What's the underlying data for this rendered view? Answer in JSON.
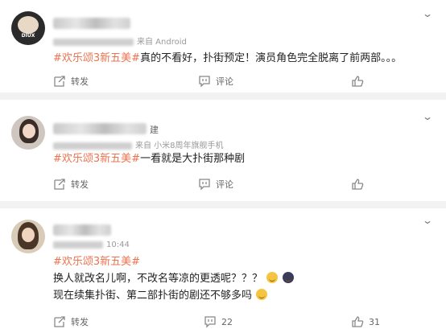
{
  "posts": [
    {
      "source": "来自 Android",
      "text_tag": "#欢乐颂3新五美#",
      "text": "真的不看好，扑街预定！演员角色完全脱离了前两部。。。",
      "repost_label": "转发",
      "comment_label": "评论",
      "like_count": "",
      "avatar_caption": "DIUX"
    },
    {
      "name_suffix": "建",
      "source": "来自 小米8周年旗舰手机",
      "text_tag": "#欢乐颂3新五美#",
      "text": "一看就是大扑街那种剧",
      "repost_label": "转发",
      "comment_label": "评论",
      "like_count": ""
    },
    {
      "time": "10:44",
      "text_tag": "#欢乐颂3新五美#",
      "line2": "换人就改名儿啊，不改名等凉的更透呢？？？",
      "line3": "现在续集扑街、第二部扑街的剧还不够多吗",
      "repost_label": "转发",
      "comment_label": "22",
      "like_count": "31"
    }
  ],
  "colors": {
    "tag": "#eb7350",
    "separator": "#f2f2f2",
    "meta": "#9a9a9a"
  }
}
